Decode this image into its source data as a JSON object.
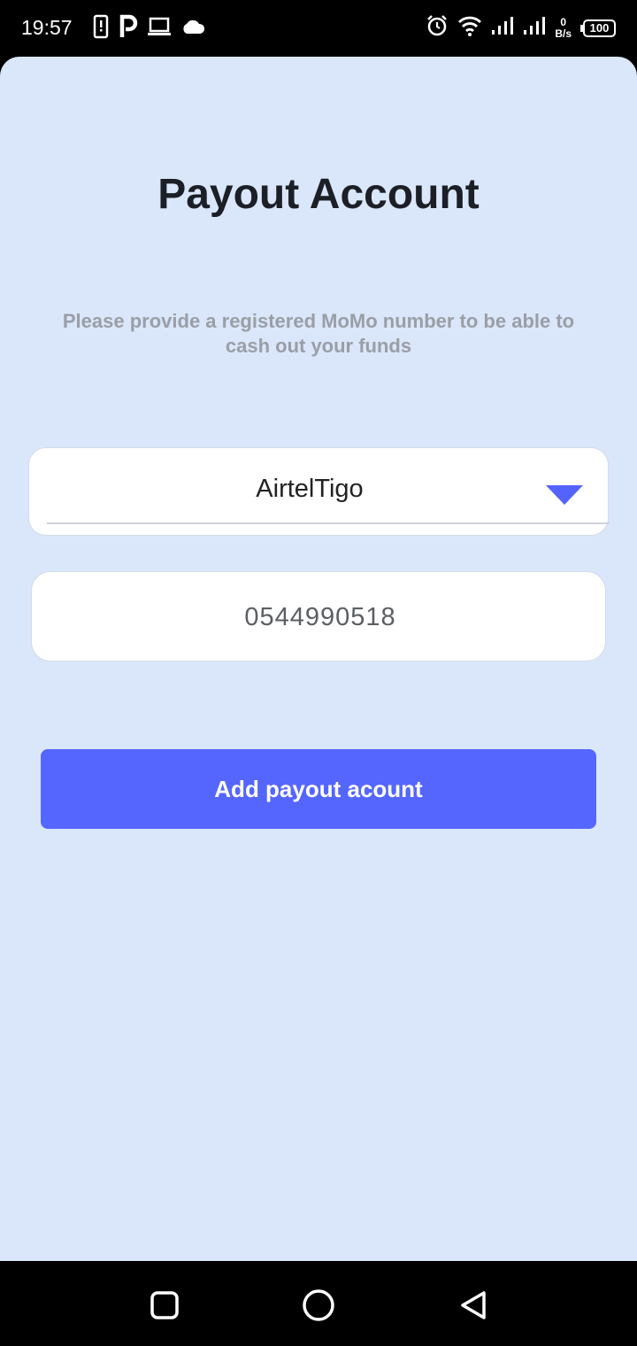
{
  "status_bar": {
    "time": "19:57",
    "net_speed_value": "0",
    "net_speed_unit": "B/s",
    "battery": "100",
    "left_icons": [
      "phone-alert-icon",
      "parking-icon",
      "laptop-icon",
      "cloud-icon"
    ],
    "right_icons": [
      "alarm-icon",
      "wifi-icon",
      "signal-icon",
      "signal-icon",
      "battery-icon"
    ]
  },
  "page": {
    "title": "Payout Account",
    "subtitle": "Please provide a registered MoMo number to be able to cash out your funds"
  },
  "form": {
    "network_select": {
      "value": "AirtelTigo",
      "icon": "dropdown-arrow-icon"
    },
    "phone_field": {
      "value": "0544990518"
    },
    "submit_label": "Add payout acount"
  },
  "nav_bar": {
    "buttons": [
      "recents-square-icon",
      "home-circle-icon",
      "back-triangle-icon"
    ]
  },
  "colors": {
    "background": "#dae7fa",
    "accent": "#5566ff",
    "title": "#1c1f26",
    "subtitle": "#9a9ea6"
  }
}
